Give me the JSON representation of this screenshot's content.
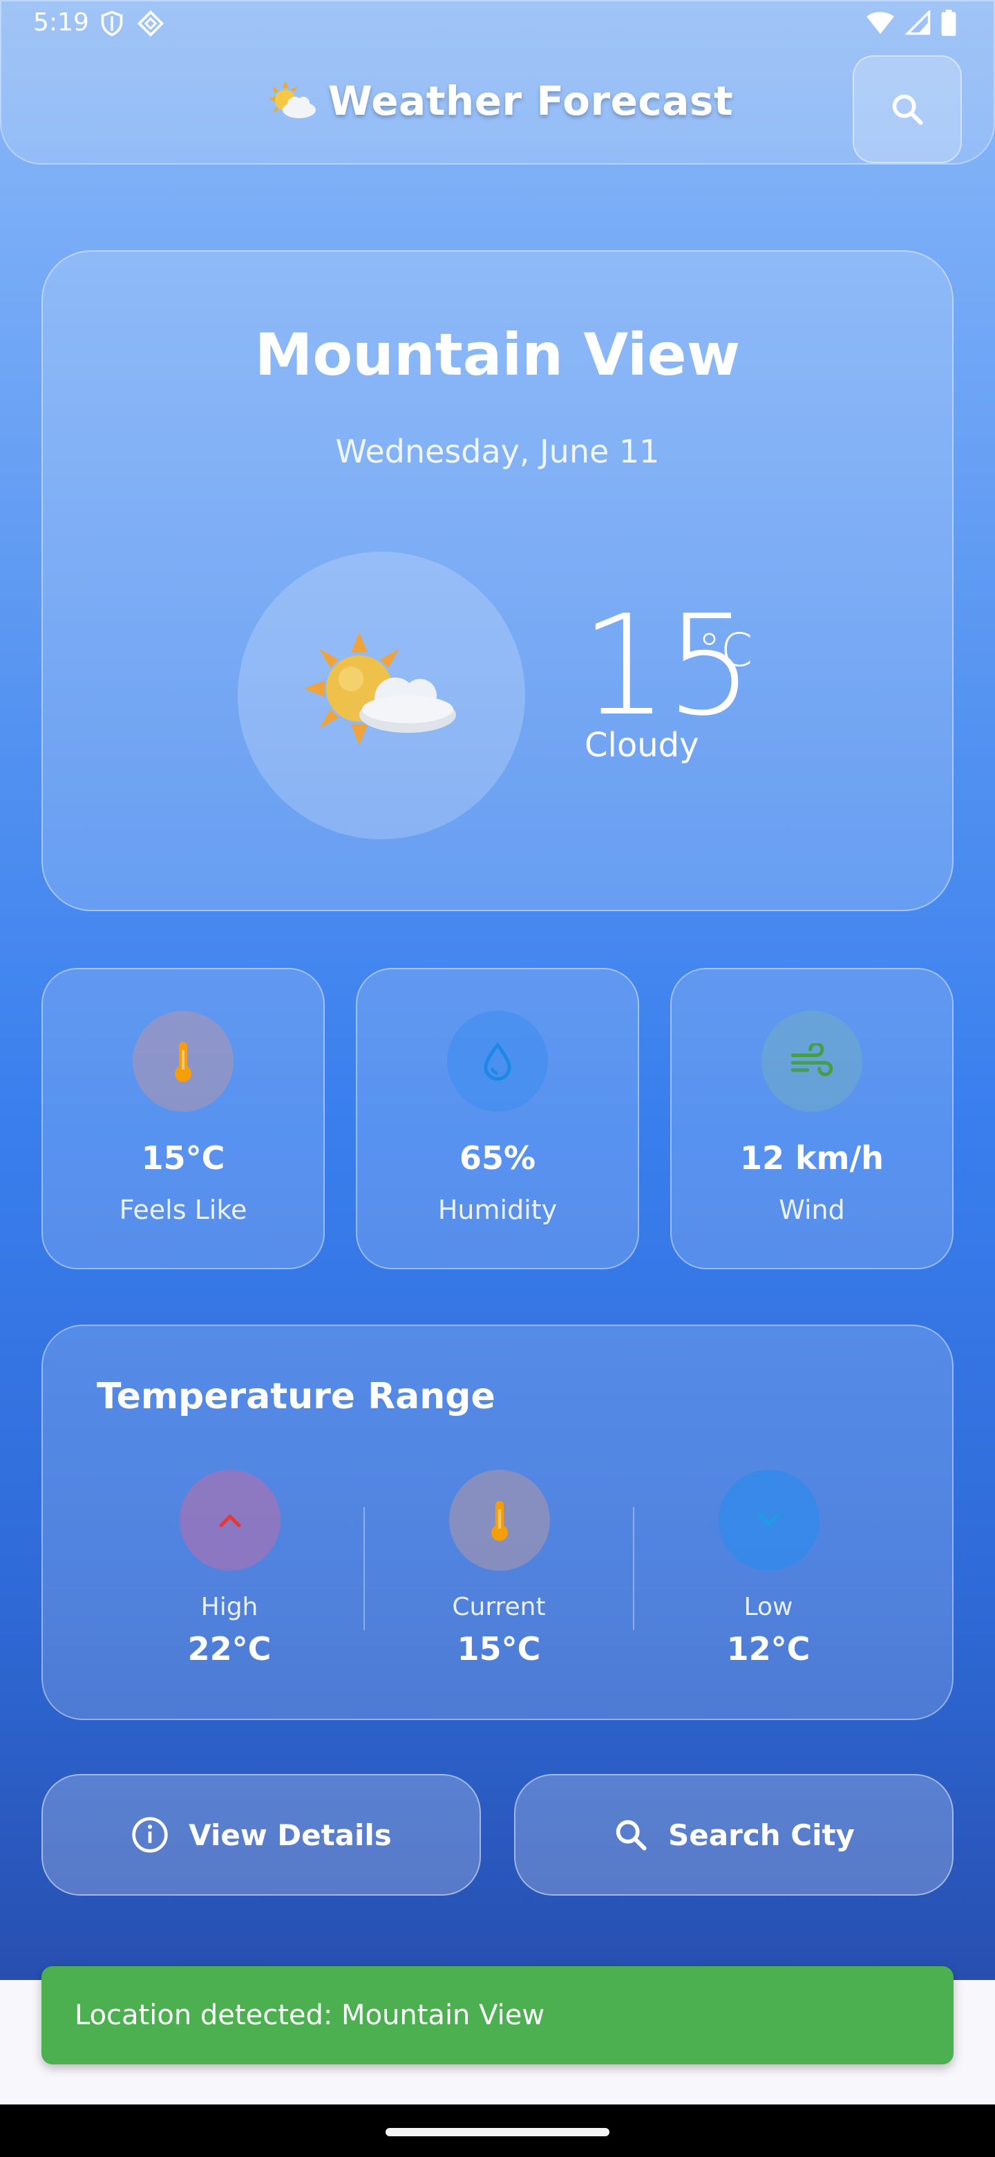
{
  "status_bar": {
    "time": "5:19"
  },
  "app_bar": {
    "title": "Weather Forecast",
    "search_icon": "search-icon"
  },
  "location": {
    "city": "Mountain View",
    "date": "Wednesday, June 11"
  },
  "current": {
    "temperature": "15",
    "unit": "°C",
    "condition": "Cloudy",
    "icon": "sun-behind-cloud-icon"
  },
  "stats": [
    {
      "value": "15°C",
      "label": "Feels Like",
      "icon": "thermometer-icon",
      "icon_color": "#f59e0b",
      "circle_color": "#9aa6c9"
    },
    {
      "value": "65%",
      "label": "Humidity",
      "icon": "water-drop-icon",
      "icon_color": "#2196f3",
      "circle_color": "#5aa2f5"
    },
    {
      "value": "12 km/h",
      "label": "Wind",
      "icon": "wind-icon",
      "icon_color": "#43a047",
      "circle_color": "#6fb0d8"
    }
  ],
  "temperature_range": {
    "title": "Temperature Range",
    "high": {
      "label": "High",
      "value": "22°C",
      "icon": "chevron-up-icon",
      "icon_color": "#e53935"
    },
    "current": {
      "label": "Current",
      "value": "15°C",
      "icon": "thermometer-icon",
      "icon_color": "#f59e0b"
    },
    "low": {
      "label": "Low",
      "value": "12°C",
      "icon": "chevron-down-icon",
      "icon_color": "#1e88e5"
    }
  },
  "actions": {
    "view_details": "View Details",
    "search_city": "Search City"
  },
  "snackbar": {
    "message": "Location detected: Mountain View",
    "color": "#4caf50"
  }
}
